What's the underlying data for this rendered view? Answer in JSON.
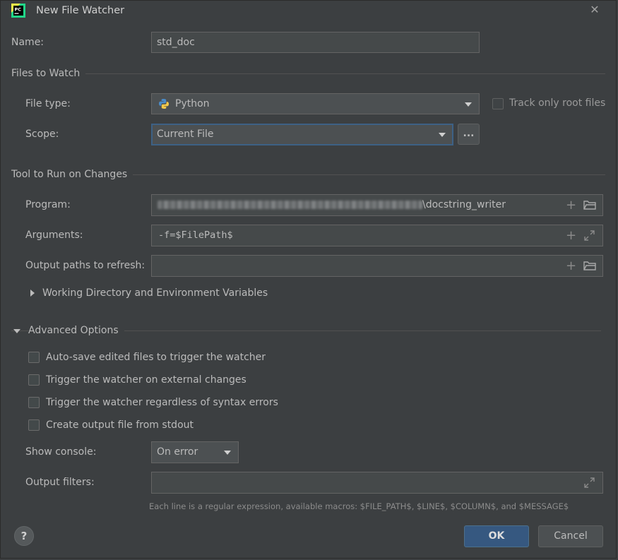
{
  "window": {
    "title": "New File Watcher",
    "app_icon": "pycharm-icon",
    "close_icon": "close-icon"
  },
  "name": {
    "label": "Name:",
    "value": "std_doc"
  },
  "files_to_watch": {
    "section": "Files to Watch",
    "file_type_label": "File type:",
    "file_type_value": "Python",
    "track_root_label": "Track only root files",
    "scope_label": "Scope:",
    "scope_value": "Current File",
    "scope_browse": "..."
  },
  "tool": {
    "section": "Tool to Run on Changes",
    "program_label": "Program:",
    "program_value_suffix": "\\docstring_writer",
    "arguments_label": "Arguments:",
    "arguments_value": "-f=$FilePath$",
    "output_paths_label": "Output paths to refresh:",
    "output_paths_value": "",
    "working_dir_label": "Working Directory and Environment Variables"
  },
  "advanced": {
    "section": "Advanced Options",
    "options": [
      {
        "label": "Auto-save edited files to trigger the watcher",
        "checked": false
      },
      {
        "label": "Trigger the watcher on external changes",
        "checked": false
      },
      {
        "label": "Trigger the watcher regardless of syntax errors",
        "checked": false
      },
      {
        "label": "Create output file from stdout",
        "checked": false
      }
    ],
    "show_console_label": "Show console:",
    "show_console_value": "On error",
    "output_filters_label": "Output filters:",
    "output_filters_value": "",
    "hint": "Each line is a regular expression, available macros: $FILE_PATH$, $LINE$, $COLUMN$, and $MESSAGE$"
  },
  "footer": {
    "help": "?",
    "ok": "OK",
    "cancel": "Cancel"
  },
  "colors": {
    "background": "#3c3f41",
    "field": "#45494a",
    "focus_border": "#3d6185",
    "primary_button": "#365880"
  }
}
